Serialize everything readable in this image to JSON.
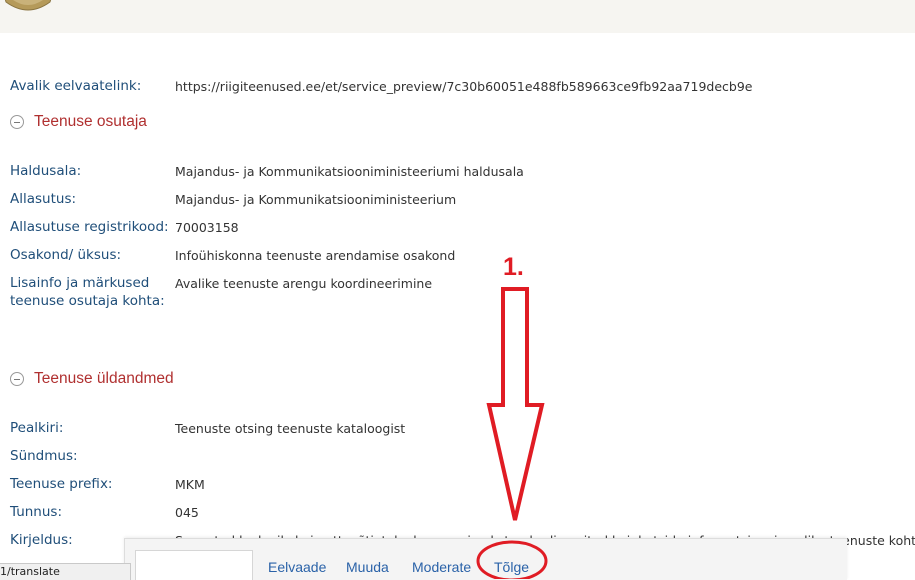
{
  "preview": {
    "label": "Avalik eelvaatelink:",
    "value": "https://riigiteenused.ee/et/service_preview/7c30b60051e488fb589663ce9fb92aa719decb9e"
  },
  "section_provider": {
    "title": "Teenuse osutaja",
    "fields": [
      {
        "label": "Haldusala:",
        "value": "Majandus- ja Kommunikatsiooniministeeriumi haldusala"
      },
      {
        "label": "Allasutus:",
        "value": "Majandus- ja Kommunikatsiooniministeerium"
      },
      {
        "label": "Allasutuse registrikood:",
        "value": "70003158"
      },
      {
        "label": "Osakond/ üksus:",
        "value": "Infoühiskonna teenuste arendamise osakond"
      },
      {
        "label": "Lisainfo ja märkused teenuse osutaja kohta:",
        "value": "Avalike teenuste arengu koordineerimine"
      }
    ]
  },
  "section_general": {
    "title": "Teenuse üldandmed",
    "fields": [
      {
        "label": "Pealkiri:",
        "value": "Teenuste otsing teenuste kataloogist"
      },
      {
        "label": "Sündmus:",
        "value": ""
      },
      {
        "label": "Teenuse prefix:",
        "value": "MKM"
      },
      {
        "label": "Tunnus:",
        "value": "045"
      },
      {
        "label": "Kirjeldus:",
        "value": "Suunatud kodanikele ja ettevõtjatele, kes soovivad standardiseeritud kujul otsida informatsiooni avalike teenuste kohta."
      }
    ]
  },
  "action_bar": {
    "links": [
      "Eelvaade",
      "Muuda",
      "Moderate",
      "Tõlge"
    ]
  },
  "status_bar": {
    "url": "1/translate"
  },
  "annotation": {
    "step_label": "1.",
    "color": "#e01c24"
  }
}
